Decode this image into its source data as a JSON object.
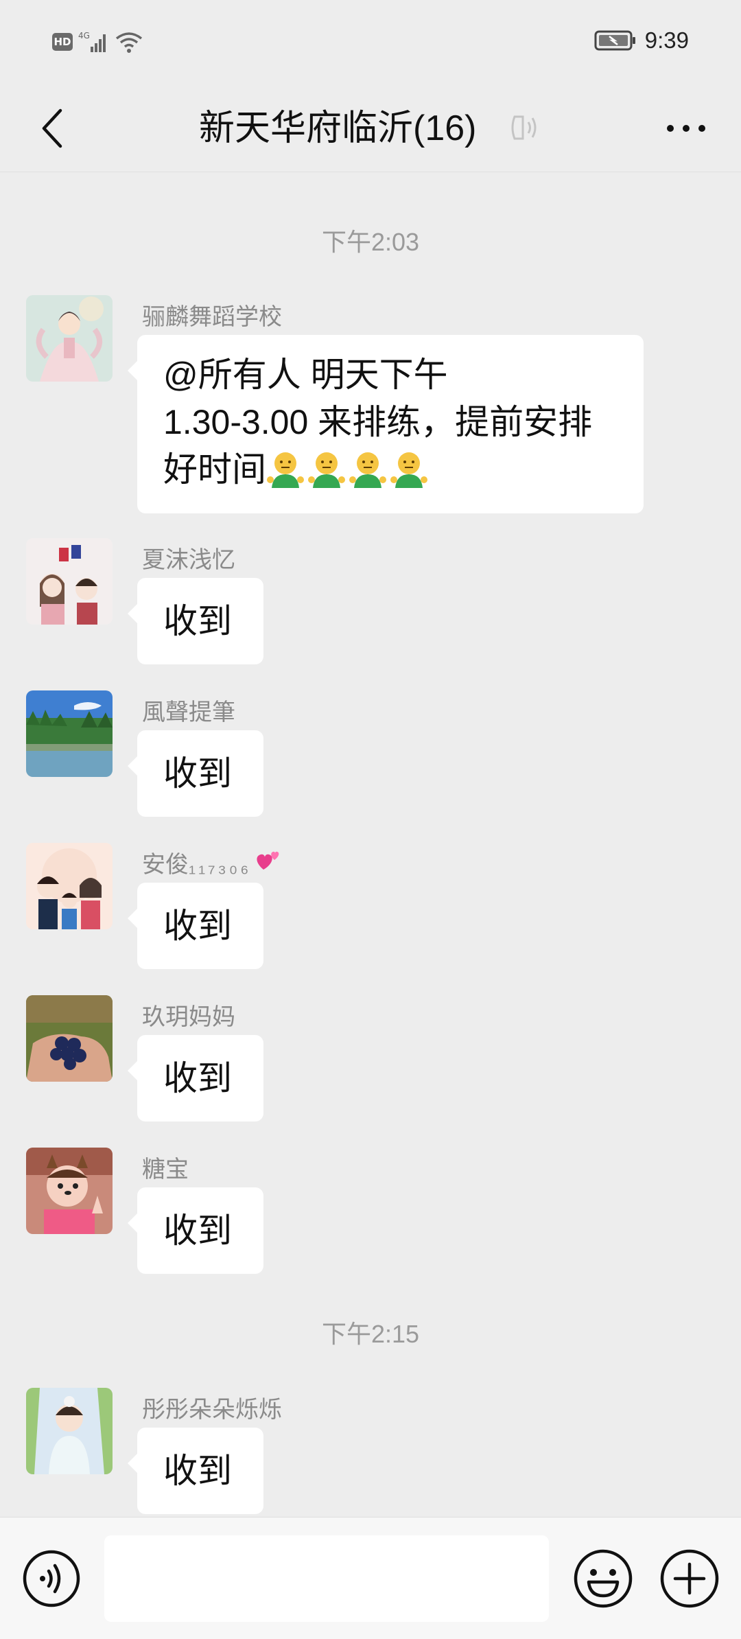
{
  "status_bar": {
    "hd_label": "HD",
    "network_label": "4G",
    "time": "9:39"
  },
  "nav": {
    "title": "新天华府临沂(16)"
  },
  "timestamps": [
    "下午2:03",
    "下午2:15"
  ],
  "messages": [
    {
      "sender": "骊麟舞蹈学校",
      "text_line1": "@所有人 明天下午",
      "text_line2": "1.30-3.00 来排练，提前安排",
      "text_line3": "好时间"
    },
    {
      "sender": "夏沫浅忆",
      "text": "收到"
    },
    {
      "sender": "風聲提筆",
      "text": "收到"
    },
    {
      "sender": "安俊",
      "sender_suffix": "₁₁₇₃₀₆",
      "text": "收到"
    },
    {
      "sender": "玖玥妈妈",
      "text": "收到"
    },
    {
      "sender": "糖宝",
      "text": "收到"
    },
    {
      "sender": "彤彤朵朵烁烁",
      "text": "收到"
    }
  ],
  "input": {
    "placeholder": ""
  },
  "colors": {
    "background": "#ededed",
    "bubble": "#ffffff",
    "name_gray": "#8a8a8a",
    "timestamp_gray": "#9a9a9a"
  },
  "icons": {
    "back": "chevron-left-icon",
    "mute": "mute-icon",
    "more": "more-icon",
    "voice": "voice-icon",
    "emoji": "emoji-icon",
    "plus": "plus-icon"
  }
}
